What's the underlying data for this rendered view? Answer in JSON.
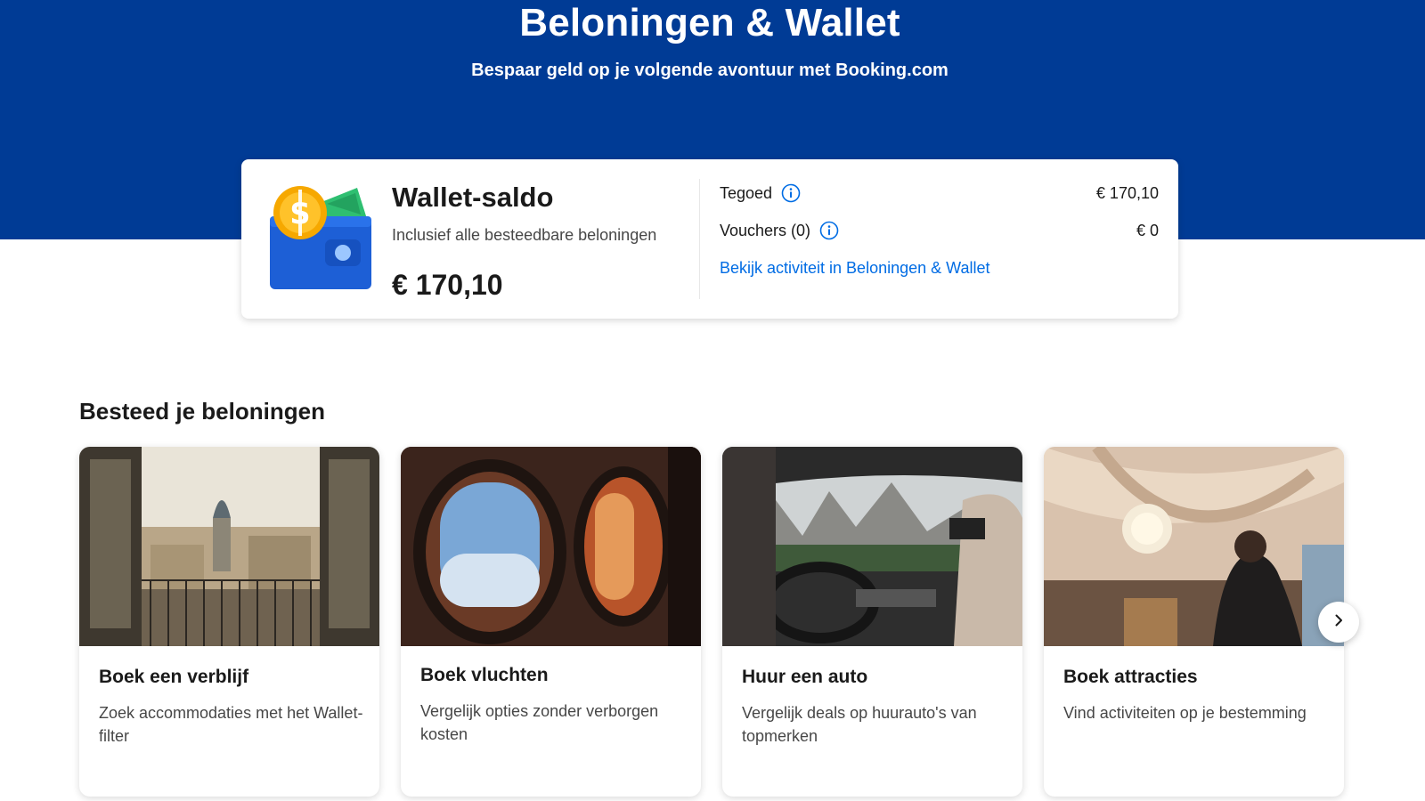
{
  "hero": {
    "title": "Beloningen & Wallet",
    "subtitle": "Bespaar geld op je volgende avontuur met Booking.com",
    "background_color": "#003b95"
  },
  "wallet": {
    "icon": "wallet-coin-icon",
    "title": "Wallet-saldo",
    "description": "Inclusief alle besteedbare beloningen",
    "balance": "€ 170,10",
    "rows": [
      {
        "label": "Tegoed",
        "icon": "info-icon",
        "value": "€ 170,10"
      },
      {
        "label": "Vouchers (0)",
        "icon": "info-icon",
        "value": "€ 0"
      }
    ],
    "activity_link": "Bekijk activiteit in Beloningen & Wallet",
    "link_color": "#006ce4"
  },
  "spend": {
    "title": "Besteed je beloningen",
    "cards": [
      {
        "title": "Boek een verblijf",
        "description": "Zoek accommodaties met het Wallet-filter",
        "image": "paris-balcony-view"
      },
      {
        "title": "Boek vluchten",
        "description": "Vergelijk opties zonder verborgen kosten",
        "image": "airplane-window-sunset"
      },
      {
        "title": "Huur een auto",
        "description": "Vergelijk deals op huurauto's van topmerken",
        "image": "car-interior-mountains"
      },
      {
        "title": "Boek attracties",
        "description": "Vind activiteiten op je bestemming",
        "image": "attraction-interior-chandelier"
      }
    ],
    "next_icon": "chevron-right-icon"
  }
}
